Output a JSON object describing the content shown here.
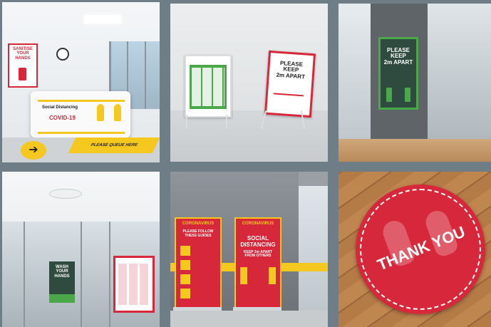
{
  "colors": {
    "frame": "#6f7d87",
    "red": "#d6283a",
    "green": "#4aa84a",
    "yellow": "#f4c81e",
    "dark_green": "#2f4a3f"
  },
  "tile1": {
    "wall_sign": "SANITISE\nYOUR\nHANDS",
    "counter_title": "Social Distancing",
    "counter_sub": "COVID-19",
    "floor_sticker": "PLEASE QUEUE HERE"
  },
  "tile2": {
    "a_board_text": "PLEASE\nKEEP\n2m APART"
  },
  "tile3": {
    "door_sign": "PLEASE\nKEEP\n2m APART"
  },
  "tile4": {
    "window_sign": "WASH\nYOUR\nHANDS"
  },
  "tile5": {
    "banner1_header": "CORONAVIRUS",
    "banner1_sub": "PLEASE FOLLOW\nTHESE GUIDES",
    "banner2_header": "CORONAVIRUS",
    "banner2_title": "SOCIAL\nDISTANCING",
    "banner2_sub": "KEEP 2m APART\nFROM OTHERS"
  },
  "tile6": {
    "sticker_text": "THANK YOU"
  }
}
